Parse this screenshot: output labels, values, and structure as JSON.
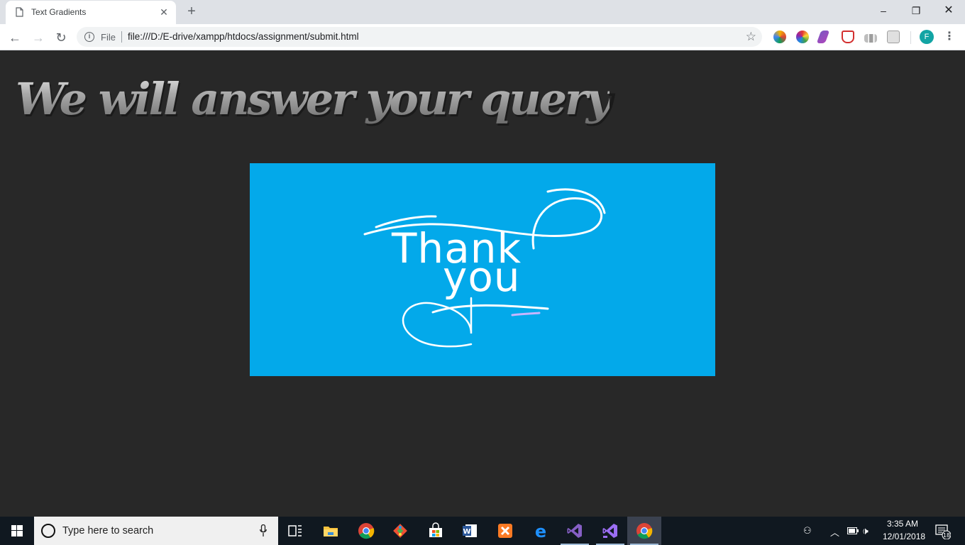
{
  "browser": {
    "tab_title": "Text Gradients",
    "address_scheme_label": "File",
    "url": "file:///D:/E-drive/xampp/htdocs/assignment/submit.html",
    "profile_initial": "F"
  },
  "page": {
    "heading": "We will answer your query",
    "card_text_line1": "Thank",
    "card_text_line2": "you",
    "card_color": "#03a9ea"
  },
  "taskbar": {
    "search_placeholder": "Type here to search",
    "time": "3:35 AM",
    "date": "12/01/2018",
    "notification_count": "18"
  },
  "icons": {
    "pinned": [
      "task-view-icon",
      "file-explorer-icon",
      "chrome-icon",
      "git-icon",
      "store-icon",
      "word-icon",
      "xampp-icon",
      "edge-icon",
      "visual-studio-icon",
      "visual-studio-preview-icon",
      "chrome-active-icon"
    ],
    "extensions": [
      "colorzilla-icon",
      "color-picker-icon",
      "feather-icon",
      "shield-icon",
      "analytics-icon",
      "cube-icon"
    ]
  }
}
